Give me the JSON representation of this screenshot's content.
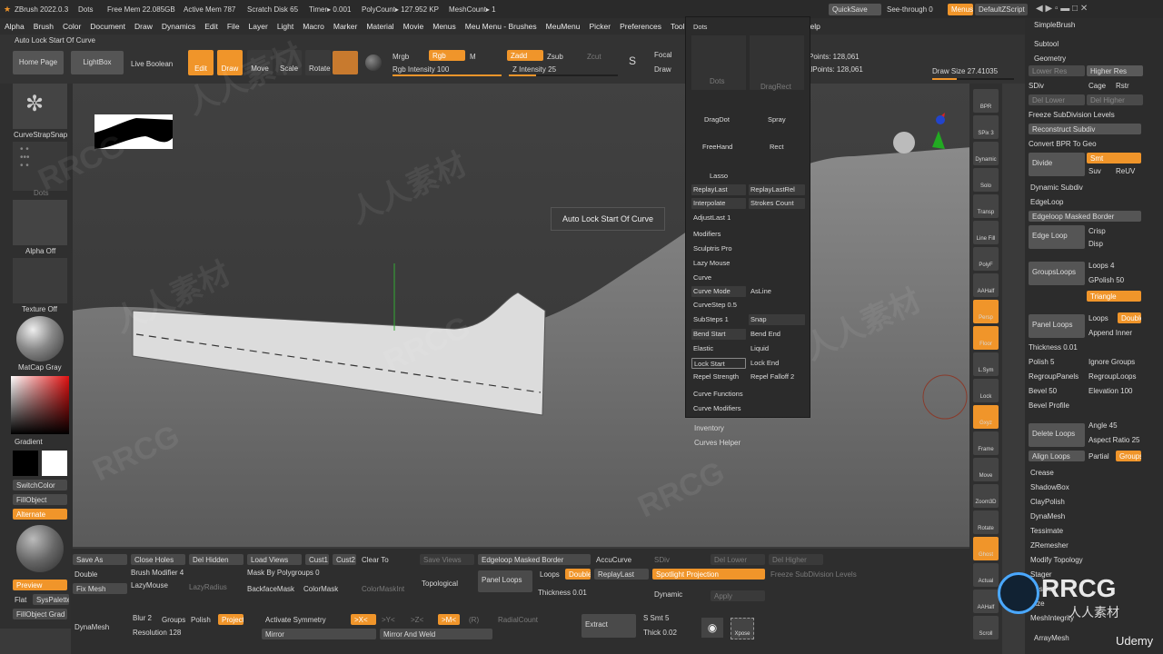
{
  "titlebar": {
    "app": "ZBrush 2022.0.3",
    "doc": "Dots",
    "free_mem": "Free Mem 22.085GB",
    "active_mem": "Active Mem 787",
    "scratch": "Scratch Disk 65",
    "timer": "Timer▸ 0.001",
    "polycount": "PolyCount▸ 127.952 KP",
    "meshcount": "MeshCount▸ 1",
    "quicksave": "QuickSave",
    "seethrough": "See-through 0",
    "menus": "Menus",
    "defaultzscript": "DefaultZScript"
  },
  "menu": [
    "Alpha",
    "Brush",
    "Color",
    "Document",
    "Draw",
    "Dynamics",
    "Edit",
    "File",
    "Layer",
    "Light",
    "Macro",
    "Marker",
    "Material",
    "Movie",
    "Menus",
    "Meu Menu - Brushes",
    "MeuMenu",
    "Picker",
    "Preferences",
    "Tool",
    "Transform",
    "Zplugin",
    "Zscript",
    "Help"
  ],
  "status": "Auto Lock Start Of Curve",
  "top": {
    "home": "Home Page",
    "lightbox": "LightBox",
    "liveboolean": "Live Boolean",
    "edit": "Edit",
    "draw": "Draw",
    "move": "Move",
    "scale": "Scale",
    "rotate": "Rotate",
    "mrgb": "Mrgb",
    "rgb": "Rgb",
    "m": "M",
    "rgb_intensity": "Rgb Intensity 100",
    "zadd": "Zadd",
    "zsub": "Zsub",
    "zcut": "Zcut",
    "z_intensity": "Z Intensity 25",
    "focal": "Focal",
    "draw_size_short": "Draw",
    "active_points": "Points: 128,061",
    "total_points": "alPoints: 128,061",
    "draw_size": "Draw Size 27.41035"
  },
  "left": {
    "brush": "CurveStrapSnap",
    "stroke": "Dots",
    "alpha": "Alpha Off",
    "texture": "Texture Off",
    "material": "MatCap Gray",
    "gradient": "Gradient",
    "switchcolor": "SwitchColor",
    "fillobject": "FillObject",
    "alternate": "Alternate"
  },
  "tooltip": "Auto Lock Start Of Curve",
  "popup": {
    "title": "Dots",
    "strokes": [
      "Dots",
      "DragRect",
      "DragDot",
      "Spray",
      "FreeHand",
      "Rect",
      "Lasso"
    ],
    "replaylast": "ReplayLast",
    "replaylastrel": "ReplayLastRel",
    "interpolate": "Interpolate",
    "strokes_count": "Strokes Count",
    "adjustlast": "AdjustLast 1",
    "modifiers": "Modifiers",
    "sculptris": "Sculptris Pro",
    "lazy": "Lazy Mouse",
    "curve": "Curve",
    "curve_mode": "Curve Mode",
    "asline": "AsLine",
    "curvestep": "CurveStep 0.5",
    "substeps": "SubSteps 1",
    "snap": "Snap",
    "bend_start": "Bend Start",
    "bend_end": "Bend End",
    "elastic": "Elastic",
    "liquid": "Liquid",
    "lock_start": "Lock Start",
    "lock_end": "Lock End",
    "repel_strength": "Repel Strength",
    "repel_falloff": "Repel Falloff 2",
    "curve_functions": "Curve Functions",
    "curve_modifiers": "Curve Modifiers",
    "inventory": "Inventory",
    "curves_helper": "Curves Helper"
  },
  "rightshelf": [
    "BPR",
    "SPix 3",
    "Dynamic",
    "Solo",
    "Transp",
    "Line Fill",
    "PolyF",
    "AAHalf",
    "Persp",
    "Floor",
    "L.Sym",
    "Lock",
    "Gxyz",
    "Frame",
    "Move",
    "Zoom3D",
    "Rotate",
    "Ghost",
    "Actual",
    "AAHalf",
    "Scroll"
  ],
  "rightpanel": {
    "simplebrush": "SimpleBrush",
    "subtool": "Subtool",
    "geometry": "Geometry",
    "lower_res": "Lower Res",
    "higher_res": "Higher Res",
    "sdiv": "SDiv",
    "cage": "Cage",
    "rstr": "Rstr",
    "del_lower": "Del Lower",
    "del_higher": "Del Higher",
    "freeze_sub": "Freeze SubDivision Levels",
    "reconstruct": "Reconstruct Subdiv",
    "convert_bpr": "Convert BPR To Geo",
    "divide": "Divide",
    "smt": "Smt",
    "suv": "Suv",
    "reuv": "ReUV",
    "dynamic_subdiv": "Dynamic Subdiv",
    "edgeloop": "EdgeLoop",
    "edgeloop_masked": "Edgeloop Masked Border",
    "edge_loop": "Edge Loop",
    "crisp": "Crisp",
    "disp": "Disp",
    "groupsloops": "GroupsLoops",
    "loops4": "Loops 4",
    "gpolish": "GPolish 50",
    "triangle": "Triangle",
    "panel_loops": "Panel Loops",
    "loops": "Loops",
    "double": "Double",
    "append_inner": "Append Inner",
    "thickness": "Thickness 0.01",
    "polish5": "Polish 5",
    "ignore_groups": "Ignore Groups",
    "regroup_panels": "RegroupPanels",
    "regroup_loops": "RegroupLoops",
    "bevel": "Bevel 50",
    "elevation": "Elevation 100",
    "bevel_profile": "Bevel Profile",
    "delete_loops": "Delete Loops",
    "angle": "Angle 45",
    "aspect_ratio": "Aspect Ratio 25",
    "align_loops": "Align Loops",
    "partial": "Partial",
    "groups": "Groups",
    "crease": "Crease",
    "shadowbox": "ShadowBox",
    "claypolish": "ClayPolish",
    "dynamesh": "DynaMesh",
    "tessimate": "Tessimate",
    "zremesher": "ZRemesher",
    "modify_topology": "Modify Topology",
    "stager": "Stager",
    "position": "Position",
    "size": "Size",
    "meshintegrity": "MeshIntegrity",
    "arraymesh": "ArrayMesh"
  },
  "bottom": {
    "save_as": "Save As",
    "double": "Double",
    "fix_mesh": "Fix Mesh",
    "close_holes": "Close Holes",
    "del_hidden": "Del Hidden",
    "load_views": "Load Views",
    "cust1": "Cust1",
    "cust2": "Cust2",
    "clear_to": "Clear To",
    "brush_modifier": "Brush Modifier 4",
    "mask_polygroups": "Mask By Polygroups 0",
    "lazymouse": "LazyMouse",
    "lazyradius": "LazyRadius",
    "backfacemask": "BackfaceMask",
    "colormask": "ColorMask",
    "colormaskint": "ColorMaskInt",
    "save_views": "Save Views",
    "topological": "Topological",
    "edgeloop_masked": "Edgeloop Masked Border",
    "accucurve": "AccuCurve",
    "sdiv": "SDiv",
    "del_lower": "Del Lower",
    "del_higher": "Del Higher",
    "panel_loops": "Panel Loops",
    "loops": "Loops",
    "double2": "Double",
    "replaylast": "ReplayLast",
    "spotlight": "Spotlight Projection",
    "freeze": "Freeze SubDivision Levels",
    "thickness": "Thickness 0.01",
    "dynamic": "Dynamic",
    "apply": "Apply",
    "dynamesh": "DynaMesh",
    "blur": "Blur 2",
    "groups": "Groups",
    "polish": "Polish",
    "project": "Project",
    "resolution": "Resolution 128",
    "activate_symmetry": "Activate Symmetry",
    "x": ">X<",
    "y": ">Y<",
    "z": ">Z<",
    "m": ">M<",
    "r": "(R)",
    "radialcount": "RadialCount",
    "mirror": "Mirror",
    "mirror_weld": "Mirror And Weld",
    "extract": "Extract",
    "s_smt": "S Smt 5",
    "thick": "Thick 0.02",
    "preview": "Preview",
    "flat": "Flat",
    "syspalette": "SysPalette",
    "fillobject_grad": "FillObject Grad",
    "xpose": "Xpose"
  },
  "watermark": [
    "RRCG",
    "人人素材"
  ],
  "logo": {
    "main": "RRCG",
    "sub": "人人素材",
    "udemy": "Udemy"
  }
}
